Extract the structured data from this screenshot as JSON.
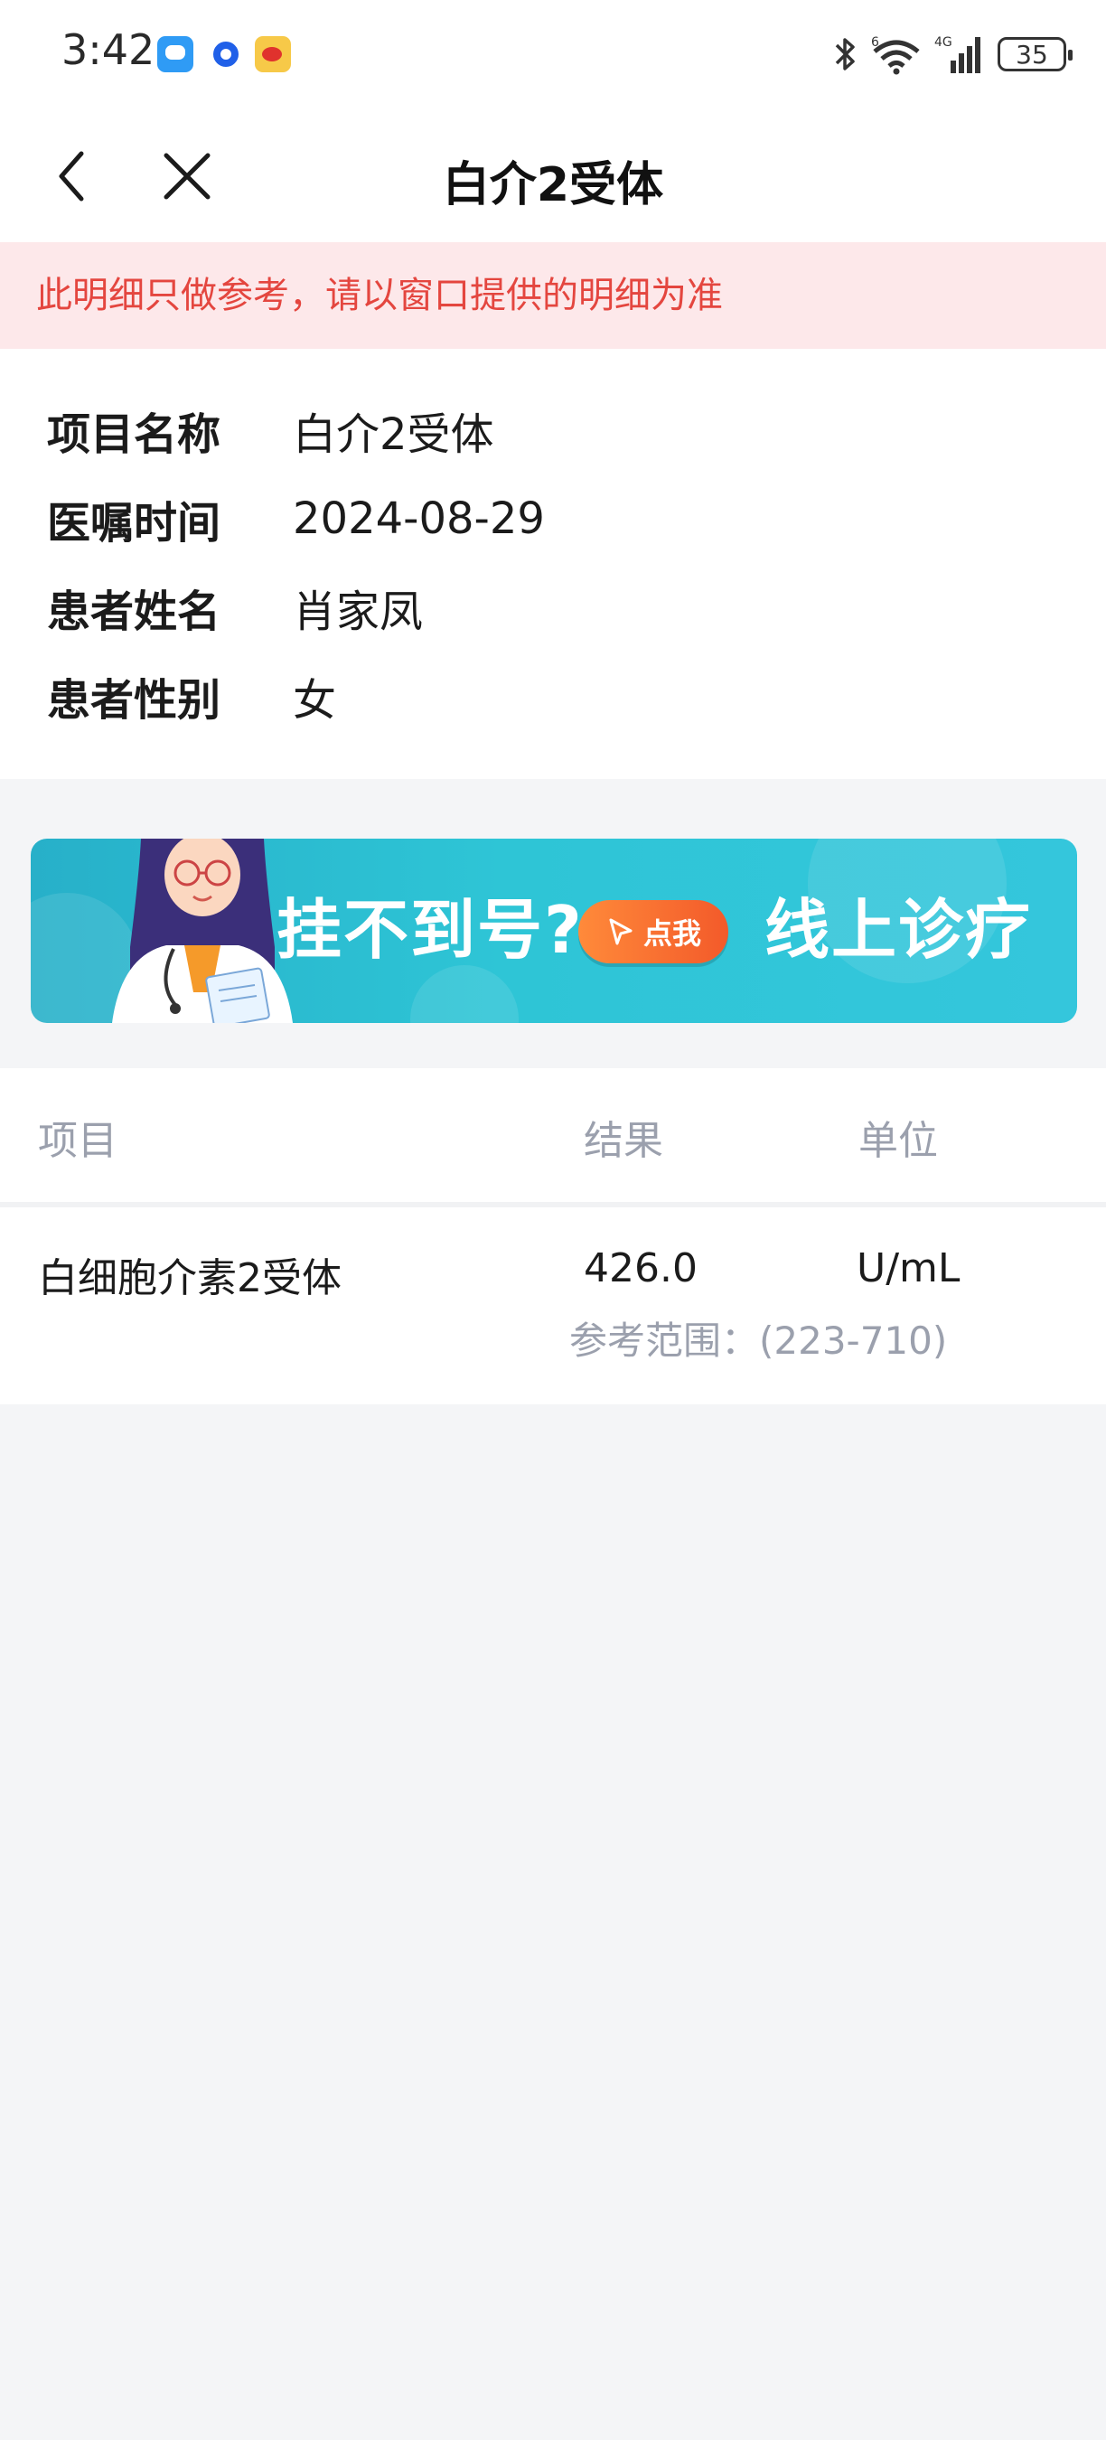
{
  "status_bar": {
    "time": "3:42",
    "network": "4G",
    "wifi_badge": "6",
    "battery": "35"
  },
  "header": {
    "title": "白介2受体"
  },
  "notice": "此明细只做参考，请以窗口提供的明细为准",
  "info": {
    "rows": [
      {
        "label": "项目名称",
        "value": "白介2受体"
      },
      {
        "label": "医嘱时间",
        "value": "2024-08-29"
      },
      {
        "label": "患者姓名",
        "value": "肖家凤"
      },
      {
        "label": "患者性别",
        "value": "女"
      }
    ]
  },
  "banner": {
    "text_left": "挂不到号?",
    "button_label": "点我",
    "text_right": "线上诊疗"
  },
  "table": {
    "headers": {
      "item": "项目",
      "result": "结果",
      "unit": "单位"
    },
    "rows": [
      {
        "name": "白细胞介素2受体",
        "result": "426.0",
        "unit": "U/mL",
        "range": "参考范围：(223-710)"
      }
    ]
  },
  "colors": {
    "notice_bg": "#fde8ea",
    "notice_text": "#e4463f",
    "banner_gradient": "#27b0c9",
    "button_orange": "#f35a2a",
    "page_bg": "#f4f5f7"
  }
}
